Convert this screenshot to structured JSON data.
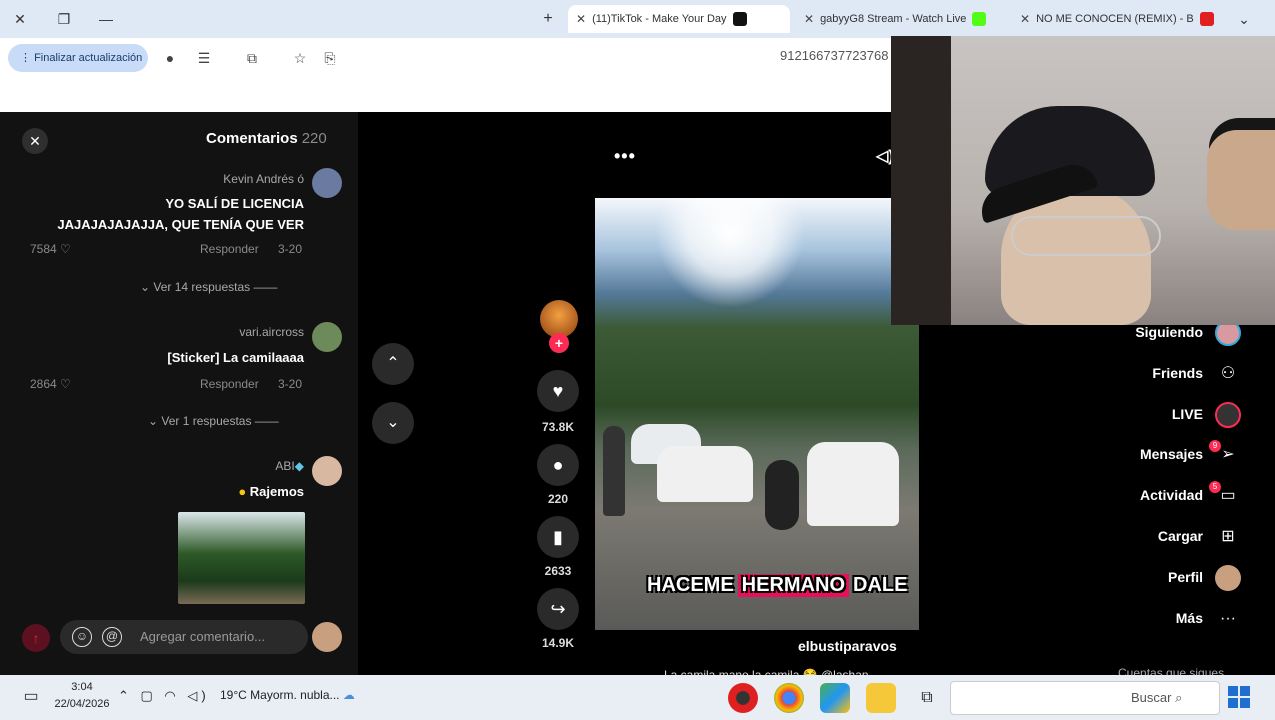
{
  "browser": {
    "tabs": [
      {
        "title": "NO ME CONOCEN (REMIX) - B",
        "favicon_color": "#e02020"
      },
      {
        "title": "gabyyG8 Stream - Watch Live",
        "favicon_color": "#53fc18"
      },
      {
        "title": "(11)TikTok - Make Your Day",
        "favicon_color": "#111111",
        "active": true
      }
    ],
    "tab_close": "✕",
    "new_tab": "+",
    "update_button": "Finalizar actualización",
    "url": "912166737723768",
    "window_controls": {
      "minimize": "—",
      "maximize": "❐",
      "close": "✕"
    }
  },
  "comments": {
    "title": "Comentarios",
    "count": "220",
    "close_icon": "✕",
    "items": [
      {
        "user": "Kevin Andrés ó",
        "text_line1": "YO SALÍ DE LICENCIA",
        "text_line2": "JAJAJAJAJAJJA, QUE TENÍA QUE VER",
        "date": "3-20",
        "reply": "Responder",
        "likes": "7584",
        "view_replies": "Ver 14 respuestas",
        "avatar_color": "#6a7aa0"
      },
      {
        "user": "vari.aircross",
        "text_line1": "[Sticker] La camilaaaa",
        "date": "3-20",
        "reply": "Responder",
        "likes": "2864",
        "view_replies": "Ver 1 respuestas",
        "avatar_color": "#6c8a5a"
      },
      {
        "user": "ABI",
        "text_line1": "Rajemos",
        "avatar_color": "#d8b8a0"
      }
    ],
    "input_placeholder": "Agregar comentario..."
  },
  "video": {
    "likes": "73.8K",
    "comments": "220",
    "saves": "2633",
    "shares": "14.9K",
    "overlay_text": [
      "DALE",
      "HERMANO",
      "HACEME"
    ],
    "author": "elbustiparavos",
    "description": "La camila mano la camila 😂 @lashan...",
    "more": "•••"
  },
  "sidebar": {
    "items": [
      {
        "label": "Siguiendo",
        "icon": "following-avatar-icon"
      },
      {
        "label": "Friends",
        "icon": "friends-icon"
      },
      {
        "label": "LIVE",
        "icon": "live-icon"
      },
      {
        "label": "Mensajes",
        "icon": "messages-icon",
        "badge": "9"
      },
      {
        "label": "Actividad",
        "icon": "activity-icon",
        "badge": "5"
      },
      {
        "label": "Cargar",
        "icon": "upload-icon"
      },
      {
        "label": "Perfil",
        "icon": "profile-icon"
      },
      {
        "label": "Más",
        "icon": "more-icon"
      }
    ],
    "footer": "Cuentas que sigues"
  },
  "taskbar": {
    "search_placeholder": "Buscar",
    "weather": "19°C  Mayorm. nubla...",
    "time": "3:04",
    "date": "22/04/2026"
  }
}
